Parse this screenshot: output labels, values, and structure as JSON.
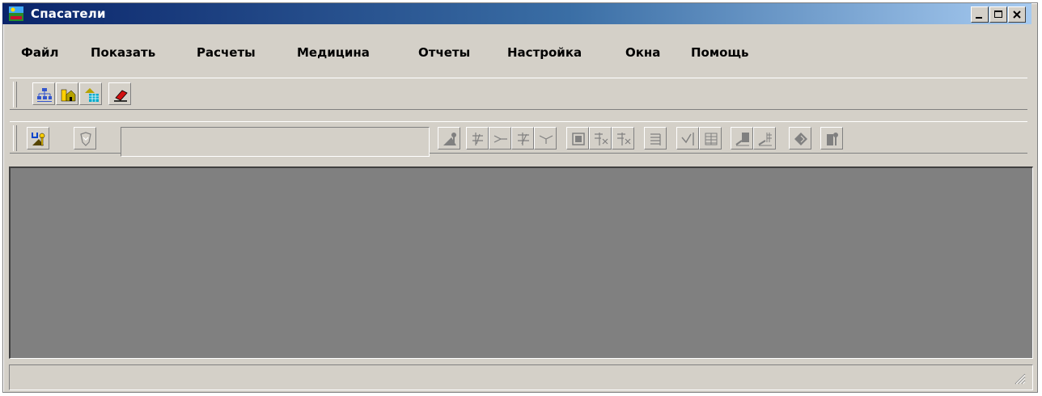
{
  "window": {
    "title": "Спасатели",
    "controls": [
      "minimize-icon",
      "maximize-icon",
      "close-icon"
    ]
  },
  "menu": {
    "items": [
      {
        "label": "Файл"
      },
      {
        "label": "Показать"
      },
      {
        "label": "Расчеты"
      },
      {
        "label": "Медицина"
      },
      {
        "label": "Отчеты"
      },
      {
        "label": "Настройка"
      },
      {
        "label": "Окна"
      },
      {
        "label": "Помощь"
      }
    ]
  },
  "toolbar1": {
    "buttons": [
      {
        "icon": "org-chart-icon"
      },
      {
        "icon": "building-icon"
      },
      {
        "icon": "house-grid-icon"
      },
      {
        "icon": "eraser-icon"
      }
    ]
  },
  "toolbar2": {
    "combo_value": "",
    "buttons": [
      {
        "icon": "map-pin-icon"
      },
      {
        "icon": "vector-icon"
      },
      {
        "icon": "point-icon"
      },
      {
        "icon": "cross-line-icon"
      },
      {
        "icon": "branch-icon"
      },
      {
        "icon": "cross-arrows-icon"
      },
      {
        "icon": "merge-icon"
      },
      {
        "icon": "frame-icon"
      },
      {
        "icon": "split-icon"
      },
      {
        "icon": "split-alt-icon"
      },
      {
        "icon": "list-icon"
      },
      {
        "icon": "check-line-icon"
      },
      {
        "icon": "table-icon"
      },
      {
        "icon": "move-up-icon"
      },
      {
        "icon": "move-grid-icon"
      },
      {
        "icon": "diamond-icon"
      },
      {
        "icon": "settings-table-icon"
      }
    ]
  },
  "statusbar": {
    "text": ""
  },
  "colors": {
    "title_gradient_start": "#0a246a",
    "title_gradient_end": "#a6caf0",
    "window_bg": "#d4d0c8",
    "mdi_bg": "#808080"
  }
}
